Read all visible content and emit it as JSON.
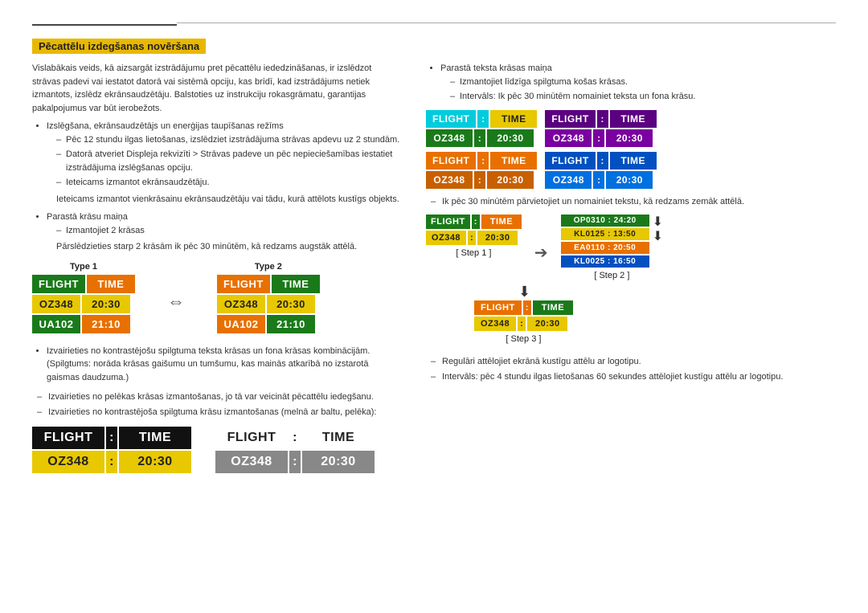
{
  "page": {
    "top_rule": true,
    "section_title": "Pēcattēlu izdegšanas novēršana",
    "intro_text": "Vislabākais veids, kā aizsargāt izstrādājumu pret pēcattēlu iededzināšanas, ir izslēdzot strāvas padevi vai iestatot datorā vai sistēmā opciju, kas brīdī, kad izstrādājums netiek izmantots, izslēdz ekrānsaudzētāju. Balstoties uz instrukciju rokasgrāmatu, garantijas pakalpojumus var būt ierobežots.",
    "bullets": [
      {
        "text": "Izslēgšana, ekrānsaudzētājs un enerģijas taupīšanas režīms",
        "subbullets": [
          "Pēc 12 stundu ilgas lietošanas, izslēdziet izstrādājuma strāvas apdevu uz 2 stundām.",
          "Datorā atveriet Displeja rekvizīti > Strāvas padeve un pēc nepieciešamības iestatiet izstrādājuma izslēgšanas opciju.",
          "Ieteicams izmantot ekrānsaudzētāju."
        ],
        "extra": "Ieteicams izmantot vienkrāsainu ekrānsaudzētāju vai tādu, kurā attēlots kustīgs objekts."
      },
      {
        "text": "Parastā krāsu maiņa",
        "subbullets": [
          "Izmantojiet 2 krāsas"
        ],
        "extra": "Pārslēdzieties starp 2 krāsām ik pēc 30 minūtēm, kā redzams augstāk attēlā."
      }
    ],
    "type1_label": "Type 1",
    "type2_label": "Type 2",
    "type1_board": {
      "header": [
        "FLIGHT",
        "TIME"
      ],
      "rows": [
        {
          "cols": [
            "OZ348",
            "20:30"
          ]
        },
        {
          "cols": [
            "UA102",
            "21:10"
          ]
        }
      ]
    },
    "type2_board": {
      "header": [
        "FLIGHT",
        "TIME"
      ],
      "rows": [
        {
          "cols": [
            "OZ348",
            "20:30"
          ]
        },
        {
          "cols": [
            "UA102",
            "21:10"
          ]
        }
      ]
    },
    "left_note1": "Izvairieties no kontrastējošu spilgtuma teksta krāsas un fona krāsas kombinācijām. (Spilgtums: norāda krāsas gaišumu un tumšumu, kas mainās atkarībā no izstarotā gaismas daudzuma.)",
    "left_dash1": "Izvairieties no pelēkas krāsas izmantošanas, jo tā var veicināt pēcattēlu iedegšanu.",
    "left_dash2": "Izvairieties no kontrastējoša spilgtuma krāsu izmantošanas (melnā ar baltu, pelēka):",
    "bottom_board_left": {
      "header": [
        "FLIGHT",
        "TIME"
      ],
      "row": "OZ348 : 20:30"
    },
    "bottom_board_right": {
      "header": [
        "FLIGHT",
        "TIME"
      ],
      "row": "OZ348 : 20:30"
    },
    "right_col": {
      "bullet1": "Parastā teksta krāsas maiņa",
      "dash1": "Izmantojiet līdzīga spilgtuma košas krāsas.",
      "dash2": "Intervāls: Ik pēc 30 minūtēm nomainiet teksta un fona krāsu.",
      "boards_row1": [
        {
          "header": [
            "FLIGHT",
            "TIME"
          ],
          "row": [
            "OZ348",
            "20:30"
          ],
          "hcols": [
            "bg-cyan",
            "bg-yellow"
          ],
          "rcols": [
            "bg-green",
            "bg-green"
          ]
        },
        {
          "header": [
            "FLIGHT",
            "TIME"
          ],
          "row": [
            "OZ348",
            "20:30"
          ],
          "hcols": [
            "bg-purple",
            "bg-purple"
          ],
          "rcols": [
            "bg-purple",
            "bg-purple"
          ]
        }
      ],
      "boards_row2": [
        {
          "header": [
            "FLIGHT",
            "TIME"
          ],
          "row": [
            "OZ348",
            "20:30"
          ],
          "hcols": [
            "bg-orange",
            "bg-orange"
          ],
          "rcols": [
            "bg-orange",
            "bg-orange"
          ]
        },
        {
          "header": [
            "FLIGHT",
            "TIME"
          ],
          "row": [
            "OZ348",
            "20:30"
          ],
          "hcols": [
            "bg-blue",
            "bg-blue"
          ],
          "rcols": [
            "bg-blue",
            "bg-blue"
          ]
        }
      ],
      "step_dash": "Ik pēc 30 minūtēm pārvietojiet un nomainiet tekstu, kā redzams zemāk attēlā.",
      "step1_label": "[ Step 1 ]",
      "step2_label": "[ Step 2 ]",
      "step3_label": "[ Step 3 ]",
      "step1_board": {
        "header": [
          "FLIGHT",
          "TIME"
        ],
        "row": [
          "OZ348",
          "20:30"
        ]
      },
      "step2_board": {
        "rows": [
          "OP0310 : 24:20",
          "KL0125 : 13:50",
          "EA0110 : 20:50",
          "KL0025 : 16:50"
        ]
      },
      "step3_board": {
        "header": [
          "FLIGHT",
          "TIME"
        ],
        "row": [
          "OZ348",
          "20:30"
        ]
      },
      "reg_dash": "Regulāri attēlojiet ekrānā kustīgu attēlu ar logotipu.",
      "reg_dash2": "Intervāls: pēc 4 stundu ilgas lietošanas 60 sekundes attēlojiet kustīgu attēlu ar logotipu."
    }
  }
}
